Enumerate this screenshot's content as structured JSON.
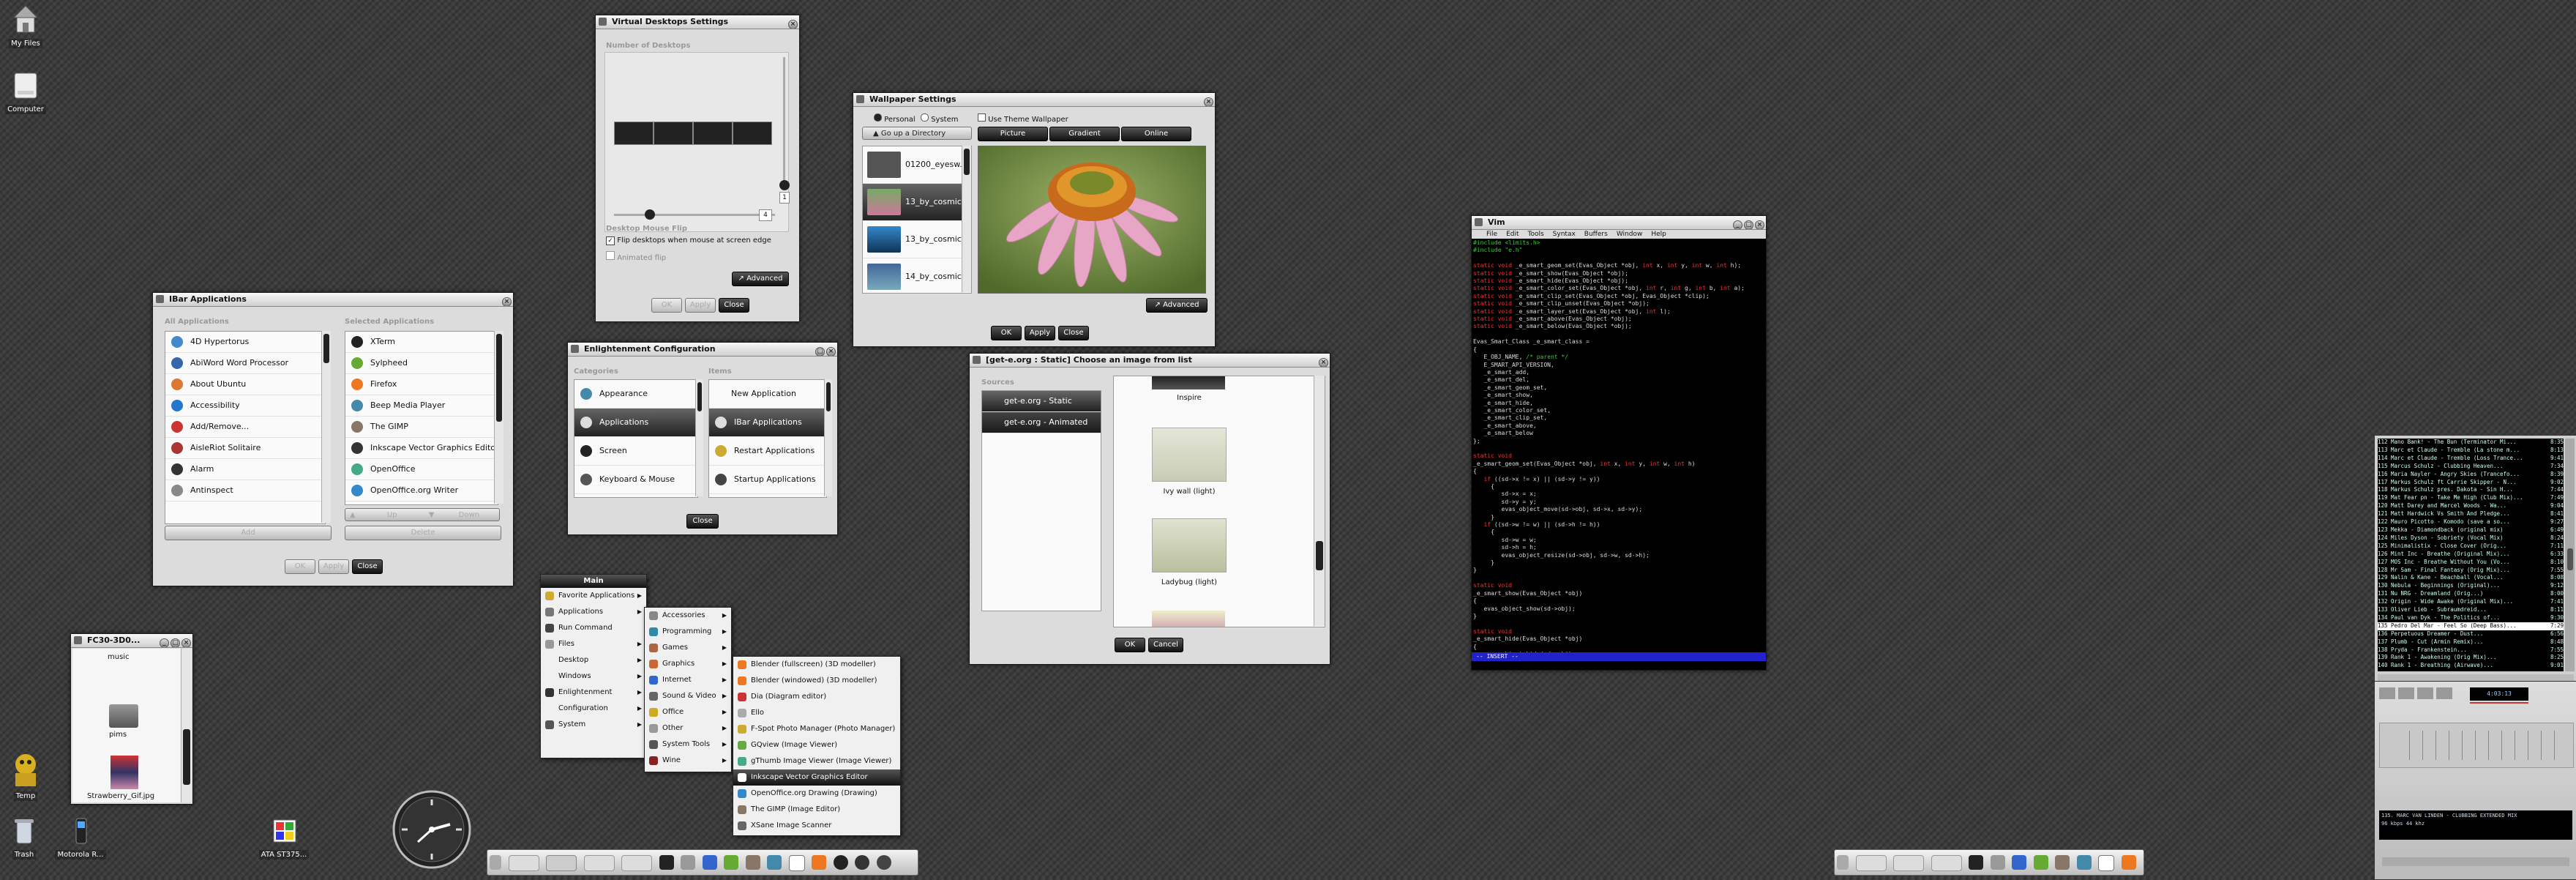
{
  "desktop": {
    "icons": [
      {
        "label": "My Files"
      },
      {
        "label": "Computer"
      },
      {
        "label": "Temp"
      },
      {
        "label": "Trash"
      },
      {
        "label": "Motorola R..."
      },
      {
        "label": "ATA ST375..."
      }
    ]
  },
  "vd": {
    "title": "Virtual Desktops Settings",
    "section": "Number of Desktops",
    "spin_value": "1",
    "spin_value2": "4",
    "flip_section": "Desktop Mouse Flip",
    "flip_edge": "Flip desktops when mouse at screen edge",
    "anim_flip": "Animated flip",
    "advanced": "Advanced",
    "ok": "OK",
    "apply": "Apply",
    "close": "Close"
  },
  "wp": {
    "title": "Wallpaper Settings",
    "personal": "Personal",
    "system": "System",
    "theme": "Use Theme Wallpaper",
    "up": "Go up a Directory",
    "picture": "Picture",
    "gradient": "Gradient",
    "online": "Online",
    "items": [
      "01200_eyesw...",
      "13_by_cosmic...",
      "13_by_cosmic...",
      "14_by_cosmic..."
    ],
    "advanced": "Advanced",
    "ok": "OK",
    "apply": "Apply",
    "close": "Close"
  },
  "ibar": {
    "title": "IBar Applications",
    "all": "All Applications",
    "selected": "Selected Applications",
    "all_items": [
      "4D Hypertorus",
      "AbiWord Word Processor",
      "About Ubuntu",
      "Accessibility",
      "Add/Remove...",
      "AisleRiot Solitaire",
      "Alarm",
      "Antinspect"
    ],
    "sel_items": [
      "XTerm",
      "Sylpheed",
      "Firefox",
      "Beep Media Player",
      "The GIMP",
      "Inkscape Vector Graphics Editor",
      "OpenOffice",
      "OpenOffice.org Writer"
    ],
    "add": "Add",
    "up": "Up",
    "down": "Down",
    "delete": "Delete",
    "ok": "OK",
    "apply": "Apply",
    "close": "Close"
  },
  "ecfg": {
    "title": "Enlightenment Configuration",
    "categories": "Categories",
    "items_label": "Items",
    "cats": [
      "Appearance",
      "Applications",
      "Screen",
      "Keyboard & Mouse"
    ],
    "items": [
      "New Application",
      "IBar Applications",
      "Restart Applications",
      "Startup Applications"
    ],
    "close": "Close"
  },
  "getmenu": {
    "main": "Main",
    "items": [
      "Favorite Applications",
      "Applications",
      "Run Command",
      "Files",
      "Desktop",
      "Windows",
      "Enlightenment",
      "Configuration",
      "System"
    ]
  },
  "apps": {
    "items": [
      "Accessories",
      "Programming",
      "Games",
      "Graphics",
      "Internet",
      "Sound & Video",
      "Office",
      "Other",
      "System Tools",
      "Wine"
    ]
  },
  "gfx": {
    "items": [
      "Blender (fullscreen) (3D modeller)",
      "Blender (windowed) (3D modeller)",
      "Dia (Diagram editor)",
      "Ello",
      "F-Spot Photo Manager (Photo Manager)",
      "GQview (Image Viewer)",
      "gThumb Image Viewer (Image Viewer)",
      "Inkscape Vector Graphics Editor",
      "OpenOffice.org Drawing (Drawing)",
      "The GIMP (Image Editor)",
      "XSane Image Scanner"
    ]
  },
  "getbg": {
    "title": "[get-e.org : Static] Choose an image from list",
    "sources": "Sources",
    "src_items": [
      "get-e.org - Static",
      "get-e.org - Animated"
    ],
    "thumbs": [
      "Inspire",
      "Ivy wall (light)",
      "Ladybug (light)"
    ],
    "ok": "OK",
    "cancel": "Cancel"
  },
  "files": {
    "title": "FC30-3D0...",
    "items": [
      "music",
      "pims",
      "Strawberry_Gif.jpg"
    ]
  },
  "vim": {
    "title": "Vim",
    "menu": [
      "File",
      "Edit",
      "Tools",
      "Syntax",
      "Buffers",
      "Window",
      "Help"
    ],
    "status": "-- INSERT --"
  },
  "player": {
    "time": "4:03:13",
    "kbps": "96",
    "khz": "44",
    "scroller": "135. MARC VAN LINDEN - CLUBBING EXTENDED MIX"
  },
  "playlist": [
    "Mano Bank! - The Bun (Terminator Mi...",
    "Marc et Claude - Tremble (La stone m...",
    "Marc et Claude - Tremble (Loss Trance...",
    "Marcus Schulz - Clubbing Heaven...",
    "Maria Nayler - Angry Skies (Trancefo...",
    "Markus Schulz ft Carrie Skipper - N...",
    "Markus Schulz pres. Dakota - Sin H...",
    "Mat Fear pn - Take Me High (Club Mix)...",
    "Matt Darey and Marcel Woods - Wa...",
    "Matt Hardwick Vs Smith And Pledge...",
    "Mauro Picotto - Komodo (save a so...",
    "Mekka - Diamondback (original mix)",
    "Miles Dyson - Sobriety (Vocal Mix)",
    "Minimalistix - Close Cover (Orig...",
    "Mint Inc - Breathe (Original Mix)...",
    "MOS Inc - Breathe Without You (Vo...",
    "Mr Sam - Final Fantasy (Orig Mix)...",
    "Nalin & Kane - Beachball (Vocal...",
    "Nebula - Beginnings (Original)...",
    "Nu NRG - Dreamland (Orig...)",
    "Origin - Wide Awake (Original Mix)...",
    "Oliver Lieb - Subraumdreid...",
    "Paul van Dyk - The Politics of...",
    "Pedro Del Mar - Feel So (Deep Bass)...",
    "Perpetuous Dreamer - Dust...",
    "Plumb - Cut (Armin Remix)...",
    "Pryda - Frankenstein...",
    "Rank 1 - Awakening (Orig Mix)...",
    "Rank 1 - Breathing (Airwave)..."
  ],
  "playlist_times": [
    "8:35",
    "8:13",
    "9:41",
    "7:34",
    "8:39",
    "9:02",
    "7:44",
    "7:49",
    "9:04",
    "8:41",
    "9:27",
    "6:49",
    "8:24",
    "7:11",
    "6:33",
    "8:10",
    "7:55",
    "8:08",
    "9:12",
    "8:00",
    "7:41",
    "8:11",
    "9:30",
    "7:29",
    "6:56",
    "8:48",
    "7:55",
    "8:25",
    "9:01"
  ],
  "playlist_nums": [
    "112",
    "113",
    "114",
    "115",
    "116",
    "117",
    "118",
    "119",
    "120",
    "121",
    "122",
    "123",
    "124",
    "125",
    "126",
    "127",
    "128",
    "129",
    "130",
    "131",
    "132",
    "133",
    "134",
    "135",
    "136",
    "137",
    "138",
    "139",
    "140"
  ]
}
